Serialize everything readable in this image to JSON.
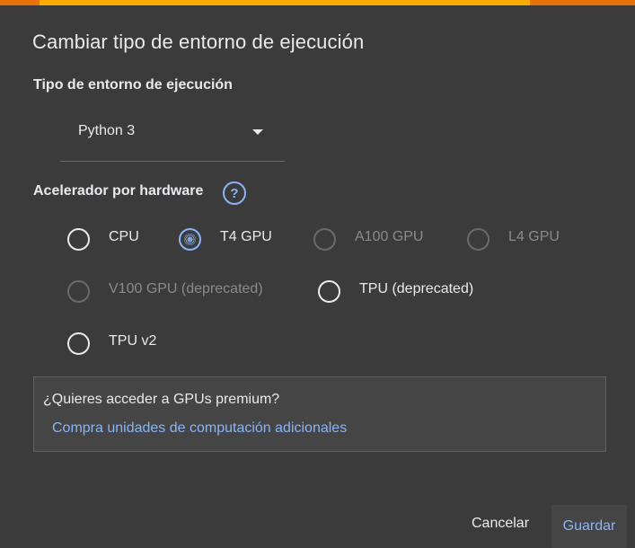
{
  "dialog": {
    "title": "Cambiar tipo de entorno de ejecución",
    "runtime_label": "Tipo de entorno de ejecución",
    "runtime_value": "Python 3",
    "accelerator_label": "Acelerador por hardware",
    "help_glyph": "?",
    "accelerators": [
      {
        "label": "CPU",
        "selected": false,
        "disabled": false
      },
      {
        "label": "T4 GPU",
        "selected": true,
        "disabled": false
      },
      {
        "label": "A100 GPU",
        "selected": false,
        "disabled": true
      },
      {
        "label": "L4 GPU",
        "selected": false,
        "disabled": true
      },
      {
        "label": "V100 GPU (deprecated)",
        "selected": false,
        "disabled": true
      },
      {
        "label": "TPU (deprecated)",
        "selected": false,
        "disabled": false
      },
      {
        "label": "TPU v2",
        "selected": false,
        "disabled": false
      }
    ],
    "premium_question": "¿Quieres acceder a GPUs premium?",
    "premium_link": "Compra unidades de computación adicionales",
    "cancel_label": "Cancelar",
    "save_label": "Guardar"
  },
  "colors": {
    "background": "#3b3b3b",
    "accent": "#8ab4f8",
    "top_bar_primary": "#f9ab00",
    "top_bar_secondary": "#e8710a"
  }
}
